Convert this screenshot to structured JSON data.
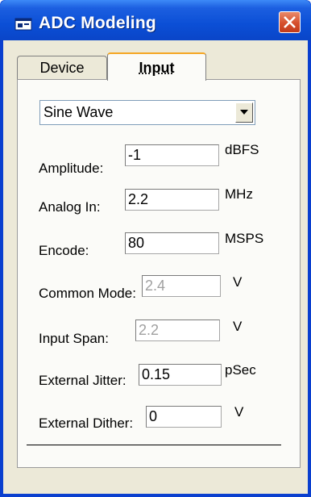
{
  "window": {
    "title": "ADC Modeling",
    "icon": "app-icon",
    "close_icon": "close-icon",
    "titlebar_color": "#0b4fd6",
    "close_color": "#d6502d"
  },
  "tabs": [
    {
      "label": "Device",
      "selected": false
    },
    {
      "label": "Input",
      "selected": true
    }
  ],
  "waveform_select": {
    "value": "Sine Wave"
  },
  "fields": {
    "amplitude": {
      "label": "Amplitude:",
      "value": "-1",
      "unit": "dBFS",
      "enabled": true
    },
    "analog_in": {
      "label": "Analog In:",
      "value": "2.2",
      "unit": "MHz",
      "enabled": true
    },
    "encode": {
      "label": "Encode:",
      "value": "80",
      "unit": "MSPS",
      "enabled": true
    },
    "common_mode": {
      "label": "Common Mode:",
      "value": "2.4",
      "unit": "V",
      "enabled": false
    },
    "input_span": {
      "label": "Input Span:",
      "value": "2.2",
      "unit": "V",
      "enabled": false
    },
    "external_jitter": {
      "label": "External Jitter:",
      "value": "0.15",
      "unit": "pSec",
      "enabled": true
    },
    "external_dither": {
      "label": "External Dither:",
      "value": "0",
      "unit": "V",
      "enabled": true
    }
  }
}
